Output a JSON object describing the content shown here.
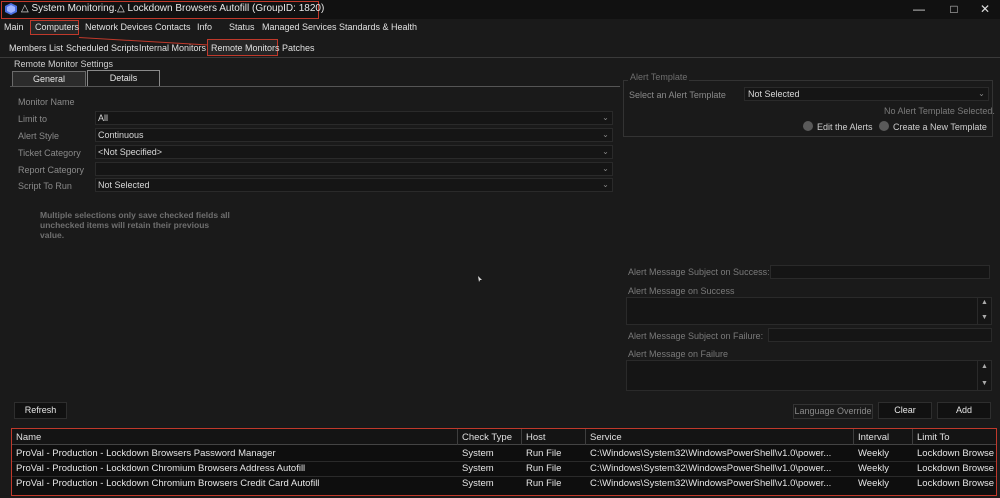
{
  "window": {
    "title": "△ System Monitoring.△ Lockdown Browsers Autofill   (GroupID: 1820)",
    "controls": {
      "minimize": "—",
      "maximize": "□",
      "close": "✕"
    }
  },
  "main_menu": [
    "Main",
    "Computers",
    "Network Devices",
    "Contacts",
    "Info",
    "Status",
    "Managed Services",
    "Standards & Health"
  ],
  "sub_tabs": [
    "Members List",
    "Scheduled Scripts",
    "Internal Monitors",
    "Remote Monitors",
    "Patches"
  ],
  "settings": {
    "group_label": "Remote Monitor Settings",
    "tabs": [
      "General",
      "Details"
    ],
    "fields": {
      "monitor_name": {
        "label": "Monitor Name"
      },
      "limit_to": {
        "label": "Limit to",
        "value": "All"
      },
      "alert_style": {
        "label": "Alert Style",
        "value": "Continuous"
      },
      "ticket_category": {
        "label": "Ticket Category",
        "value": "<Not Specified>"
      },
      "report_category": {
        "label": "Report Category",
        "value": ""
      },
      "script_to_run": {
        "label": "Script To Run",
        "value": "Not Selected"
      }
    },
    "note": "Multiple selections only save checked fields all unchecked items will retain their previous value."
  },
  "alert_template": {
    "group_label": "Alert Template",
    "select_label": "Select an Alert Template",
    "select_value": "Not Selected",
    "none_text": "No Alert Template Selected.",
    "edit_label": "Edit the Alerts",
    "create_label": "Create a New Template"
  },
  "messages": {
    "subject_success_label": "Alert Message Subject on Success:",
    "success_label": "Alert Message on Success",
    "subject_failure_label": "Alert Message Subject on Failure:",
    "failure_label": "Alert Message on Failure"
  },
  "buttons": {
    "refresh": "Refresh",
    "language_override": "Language Override",
    "clear": "Clear",
    "add": "Add"
  },
  "table": {
    "columns": [
      "Name",
      "Check Type",
      "Host",
      "Service",
      "Interval",
      "Limit To"
    ],
    "rows": [
      [
        "ProVal - Production - Lockdown Browsers Password Manager",
        "System",
        "Run File",
        "C:\\Windows\\System32\\WindowsPowerShell\\v1.0\\power...",
        "Weekly",
        "Lockdown Browse"
      ],
      [
        "ProVal - Production - Lockdown Chromium Browsers Address Autofill",
        "System",
        "Run File",
        "C:\\Windows\\System32\\WindowsPowerShell\\v1.0\\power...",
        "Weekly",
        "Lockdown Browse"
      ],
      [
        "ProVal - Production - Lockdown Chromium Browsers Credit Card Autofill",
        "System",
        "Run File",
        "C:\\Windows\\System32\\WindowsPowerShell\\v1.0\\power...",
        "Weekly",
        "Lockdown Browse"
      ]
    ]
  },
  "colors": {
    "background": "#1a1a1a",
    "highlight_border": "#c0392b",
    "text": "#e0e0e0",
    "muted_text": "#8a8a8a"
  }
}
